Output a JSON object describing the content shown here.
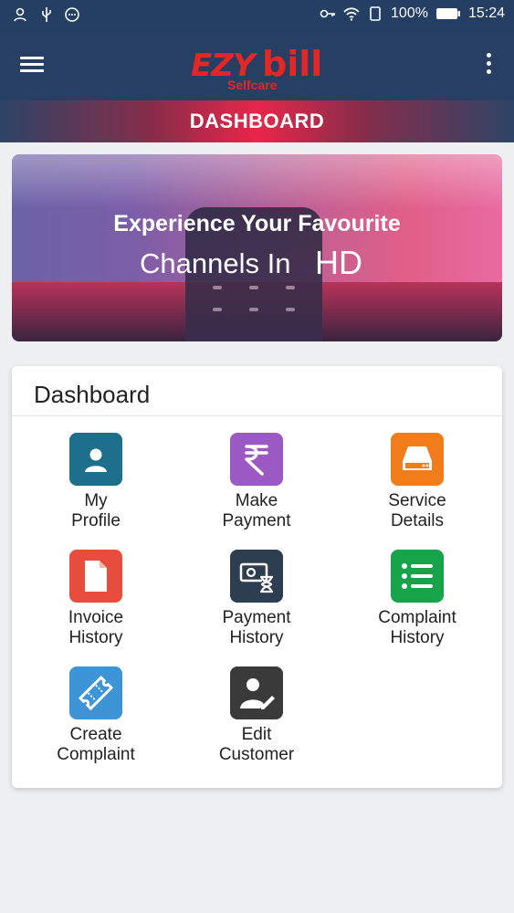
{
  "status_bar": {
    "battery": "100%",
    "time": "15:24",
    "icons": [
      "account-icon",
      "usb-icon",
      "notification-icon",
      "key-icon",
      "wifi-icon",
      "sim-icon",
      "battery-icon"
    ]
  },
  "app_bar": {
    "logo_main_left": "EZY",
    "logo_main_right": "bill",
    "logo_sub": "Selfcare",
    "menu_icon": "hamburger-icon",
    "more_icon": "more-vertical-icon"
  },
  "page_title": "DASHBOARD",
  "banner": {
    "line1": "Experience Your Favourite",
    "line2": "Channels In",
    "line2_emphasis": "HD"
  },
  "dashboard": {
    "title": "Dashboard",
    "tiles": [
      {
        "line1": "My",
        "line2": "Profile",
        "icon": "profile-icon",
        "color": "#1e6f8c"
      },
      {
        "line1": "Make",
        "line2": "Payment",
        "icon": "rupee-icon",
        "color": "#9b59c4"
      },
      {
        "line1": "Service",
        "line2": "Details",
        "icon": "device-icon",
        "color": "#f07d1a"
      },
      {
        "line1": "Invoice",
        "line2": "History",
        "icon": "document-icon",
        "color": "#e74c3c"
      },
      {
        "line1": "Payment",
        "line2": "History",
        "icon": "money-hourglass-icon",
        "color": "#2c3e50"
      },
      {
        "line1": "Complaint",
        "line2": "History",
        "icon": "list-icon",
        "color": "#16a34a"
      },
      {
        "line1": "Create",
        "line2": "Complaint",
        "icon": "ticket-icon",
        "color": "#3d95d8"
      },
      {
        "line1": "Edit",
        "line2": "Customer",
        "icon": "edit-user-icon",
        "color": "#3a3a3a"
      }
    ]
  },
  "colors": {
    "primary": "#263f63",
    "accent": "#e8264a",
    "logo": "#e32626"
  }
}
